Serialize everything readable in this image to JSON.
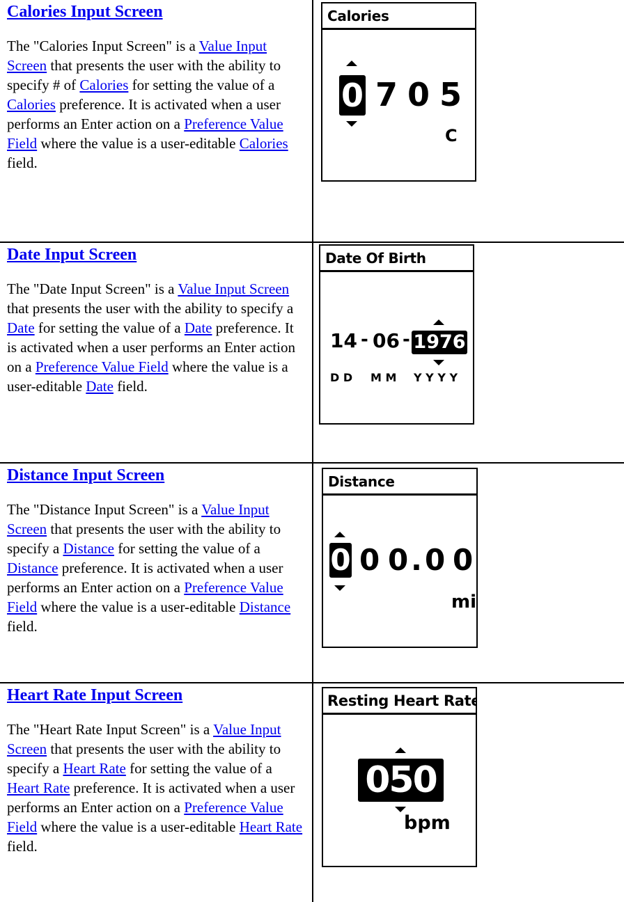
{
  "sections": [
    {
      "heading": "Calories Input Screen",
      "desc": [
        {
          "t": "The \"Calories Input Screen\" is a "
        },
        {
          "link": "Value Input Screen"
        },
        {
          "t": " that presents the user with the ability to specify # of "
        },
        {
          "link": "Calories"
        },
        {
          "t": " for setting the value of a "
        },
        {
          "link": "Calories"
        },
        {
          "t": " preference. It is activated when a user performs an Enter action on a "
        },
        {
          "link": "Preference Value Field"
        },
        {
          "t": " where the value is a user-editable "
        },
        {
          "link": "Calories"
        },
        {
          "t": " field."
        }
      ],
      "screen": {
        "title": "Calories",
        "digits": [
          "0",
          "7",
          "0",
          "5"
        ],
        "selected_index": 0,
        "unit": "C"
      }
    },
    {
      "heading": "Date Input Screen",
      "desc": [
        {
          "t": "The \"Date Input Screen\" is a "
        },
        {
          "link": "Value Input Screen"
        },
        {
          "t": " that presents the user with the ability to specify a "
        },
        {
          "link": "Date"
        },
        {
          "t": " for setting the value of a "
        },
        {
          "link": "Date"
        },
        {
          "t": " preference. It is activated when a user performs an Enter action on a "
        },
        {
          "link": "Preference Value Field"
        },
        {
          "t": " where the value is a user-editable "
        },
        {
          "link": "Date"
        },
        {
          "t": " field."
        }
      ],
      "screen": {
        "title": "Date Of Birth",
        "day": "14",
        "month": "06",
        "year": "1976",
        "separator": "-",
        "selected_field": "year",
        "format_labels": [
          "D D",
          "M M",
          "Y Y Y Y"
        ]
      }
    },
    {
      "heading": "Distance Input Screen",
      "desc": [
        {
          "t": "The \"Distance Input Screen\" is a "
        },
        {
          "link": "Value Input Screen"
        },
        {
          "t": " that presents the user with the ability to specify a "
        },
        {
          "link": "Distance"
        },
        {
          "t": " for setting the value of a "
        },
        {
          "link": "Distance"
        },
        {
          "t": " preference. It is activated when a user performs an Enter action on a "
        },
        {
          "link": "Preference Value Field"
        },
        {
          "t": " where the value is a user-editable "
        },
        {
          "link": "Distance"
        },
        {
          "t": " field."
        }
      ],
      "screen": {
        "title": "Distance",
        "digits": [
          "0",
          "0",
          "0",
          ".",
          "0",
          "0"
        ],
        "selected_index": 0,
        "unit": "mi"
      }
    },
    {
      "heading": "Heart Rate Input Screen",
      "desc": [
        {
          "t": "The \"Heart Rate Input Screen\" is a "
        },
        {
          "link": "Value Input Screen"
        },
        {
          "t": " that presents the user with the ability to specify a "
        },
        {
          "link": "Heart Rate"
        },
        {
          "t": " for setting the value of a "
        },
        {
          "link": "Heart Rate"
        },
        {
          "t": " preference. It is activated when a user performs an Enter action on a "
        },
        {
          "link": "Preference Value Field"
        },
        {
          "t": " where the value is a user-editable "
        },
        {
          "link": "Heart Rate"
        },
        {
          "t": " field."
        }
      ],
      "screen": {
        "title": "Resting Heart Rate",
        "value": "050",
        "unit": "bpm"
      }
    }
  ],
  "colors": {
    "link": "#0000ee",
    "text": "#000000",
    "border": "#000000"
  }
}
